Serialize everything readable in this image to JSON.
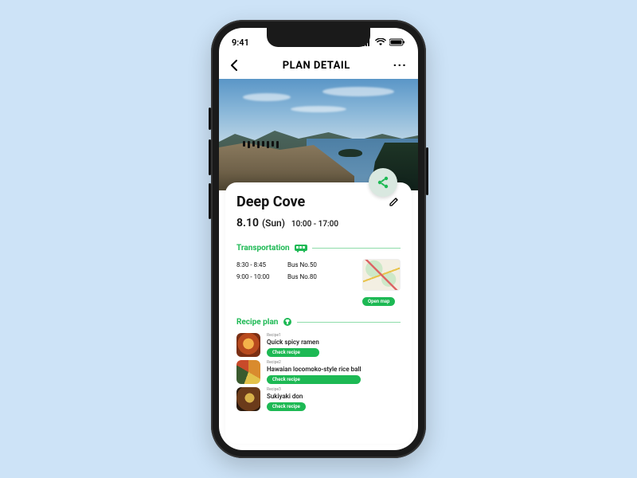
{
  "status": {
    "time": "9:41"
  },
  "header": {
    "title": "PLAN DETAIL"
  },
  "plan": {
    "title": "Deep Cove",
    "date": "8.10",
    "day": "(Sun)",
    "time": "10:00 - 17:00"
  },
  "transportation": {
    "section_label": "Transportation",
    "rows": [
      {
        "time": "8:30 - 8:45",
        "line": "Bus No.50"
      },
      {
        "time": "9:00 - 10:00",
        "line": "Bus No.80"
      }
    ],
    "open_map_label": "Open map"
  },
  "recipes": {
    "section_label": "Recipe plan",
    "check_label": "Check recipe",
    "items": [
      {
        "tag": "Recipe1",
        "name": "Quick spicy ramen"
      },
      {
        "tag": "Recipe2",
        "name": "Hawaian locomoko-style rice ball"
      },
      {
        "tag": "Recipe3",
        "name": "Sukiyaki don"
      }
    ]
  }
}
